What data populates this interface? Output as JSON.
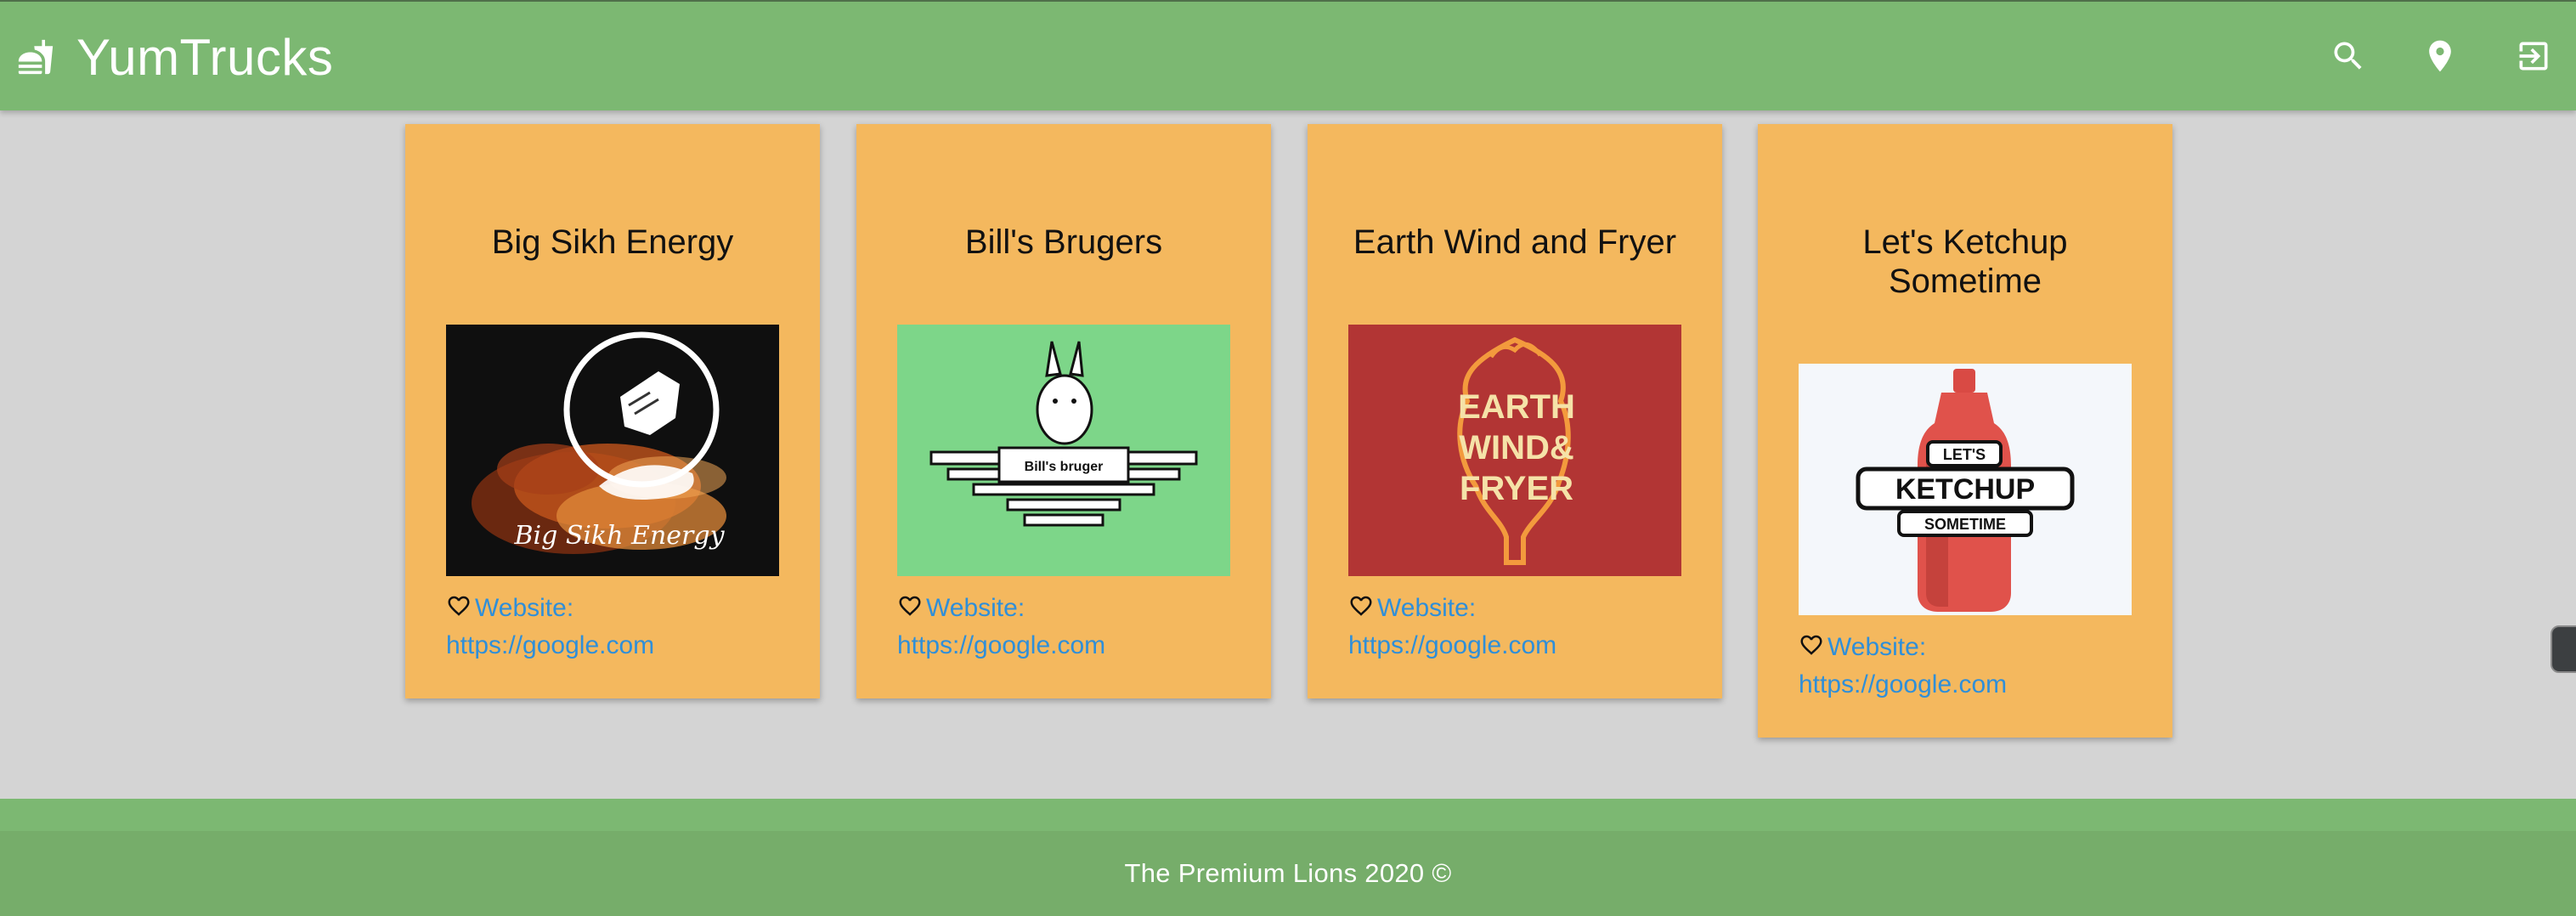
{
  "header": {
    "title": "YumTrucks",
    "brand_icon": "fastfood-icon",
    "actions": [
      {
        "name": "search",
        "icon": "search-icon"
      },
      {
        "name": "location",
        "icon": "location-pin-icon"
      },
      {
        "name": "logout",
        "icon": "logout-icon"
      }
    ],
    "background_color": "#7cb872"
  },
  "trucks": [
    {
      "name": "Big Sikh Energy",
      "logo_text": "Big Sikh Energy",
      "link_label": "Website:",
      "url": "https://google.com",
      "favorite": false
    },
    {
      "name": "Bill's Brugers",
      "logo_text": "Bill's bruger",
      "link_label": "Website:",
      "url": "https://google.com",
      "favorite": false
    },
    {
      "name": "Earth Wind and Fryer",
      "logo_text": [
        "EARTH",
        "WIND&",
        "FRYER"
      ],
      "link_label": "Website:",
      "url": "https://google.com",
      "favorite": false
    },
    {
      "name": "Let's Ketchup Sometime",
      "logo_text": [
        "LET'S",
        "KETCHUP",
        "SOMETIME"
      ],
      "link_label": "Website:",
      "url": "https://google.com",
      "favorite": false
    }
  ],
  "colors": {
    "card": "#f4b85e",
    "link": "#2f8fd9",
    "page_background": "#d4d4d4",
    "footer": "#76ad6a"
  },
  "footer": {
    "text": "The Premium Lions 2020 ©"
  }
}
